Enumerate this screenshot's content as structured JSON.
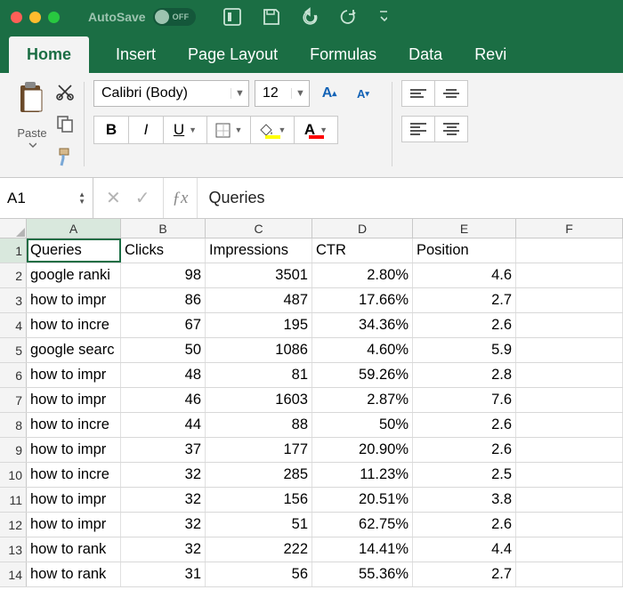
{
  "titlebar": {
    "autosave_label": "AutoSave",
    "autosave_state": "OFF"
  },
  "tabs": [
    "Home",
    "Insert",
    "Page Layout",
    "Formulas",
    "Data",
    "Revi"
  ],
  "active_tab": "Home",
  "ribbon": {
    "paste_label": "Paste",
    "font_name": "Calibri (Body)",
    "font_size": "12"
  },
  "namebox": "A1",
  "formula": "Queries",
  "columns": [
    "A",
    "B",
    "C",
    "D",
    "E",
    "F"
  ],
  "headers": {
    "A": "Queries",
    "B": "Clicks",
    "C": "Impressions",
    "D": "CTR",
    "E": "Position"
  },
  "rows": [
    {
      "n": 2,
      "q": "google ranki",
      "clicks": 98,
      "impr": 3501,
      "ctr": "2.80%",
      "pos": "4.6"
    },
    {
      "n": 3,
      "q": "how to impr",
      "clicks": 86,
      "impr": 487,
      "ctr": "17.66%",
      "pos": "2.7"
    },
    {
      "n": 4,
      "q": "how to incre",
      "clicks": 67,
      "impr": 195,
      "ctr": "34.36%",
      "pos": "2.6"
    },
    {
      "n": 5,
      "q": "google searc",
      "clicks": 50,
      "impr": 1086,
      "ctr": "4.60%",
      "pos": "5.9"
    },
    {
      "n": 6,
      "q": "how to impr",
      "clicks": 48,
      "impr": 81,
      "ctr": "59.26%",
      "pos": "2.8"
    },
    {
      "n": 7,
      "q": "how to impr",
      "clicks": 46,
      "impr": 1603,
      "ctr": "2.87%",
      "pos": "7.6"
    },
    {
      "n": 8,
      "q": "how to incre",
      "clicks": 44,
      "impr": 88,
      "ctr": "50%",
      "pos": "2.6"
    },
    {
      "n": 9,
      "q": "how to impr",
      "clicks": 37,
      "impr": 177,
      "ctr": "20.90%",
      "pos": "2.6"
    },
    {
      "n": 10,
      "q": "how to incre",
      "clicks": 32,
      "impr": 285,
      "ctr": "11.23%",
      "pos": "2.5"
    },
    {
      "n": 11,
      "q": "how to impr",
      "clicks": 32,
      "impr": 156,
      "ctr": "20.51%",
      "pos": "3.8"
    },
    {
      "n": 12,
      "q": "how to impr",
      "clicks": 32,
      "impr": 51,
      "ctr": "62.75%",
      "pos": "2.6"
    },
    {
      "n": 13,
      "q": "how to rank",
      "clicks": 32,
      "impr": 222,
      "ctr": "14.41%",
      "pos": "4.4"
    },
    {
      "n": 14,
      "q": "how to rank",
      "clicks": 31,
      "impr": 56,
      "ctr": "55.36%",
      "pos": "2.7"
    }
  ]
}
